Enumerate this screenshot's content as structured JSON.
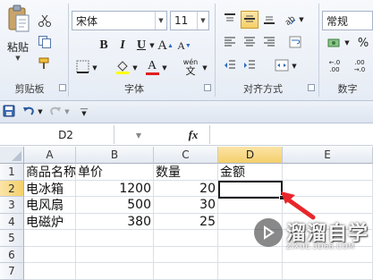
{
  "ribbon": {
    "clipboard": {
      "paste_label": "粘贴",
      "group_label": "剪贴板",
      "cut_icon": "scissors-icon",
      "copy_icon": "copy-icon",
      "format_painter_icon": "format-painter-icon"
    },
    "font": {
      "font_name": "宋体",
      "font_size": "11",
      "bold": "B",
      "italic": "I",
      "underline": "U",
      "grow_font": "A",
      "shrink_font": "A",
      "font_color_glyph": "A",
      "phonetic_label": "wén",
      "group_label": "字体",
      "highlight_color": "#ffff00",
      "font_color": "#e02020"
    },
    "alignment": {
      "group_label": "对齐方式"
    },
    "number": {
      "format_value": "常规",
      "currency_symbol": "$",
      "percent_symbol": "%",
      "comma_symbol": ",",
      "increase_decimal": ".0 .00",
      "decrease_decimal": ".00 .0",
      "group_label": "数字"
    }
  },
  "qat": {
    "save_icon": "save-icon",
    "undo_icon": "undo-icon",
    "redo_icon": "redo-icon"
  },
  "formula_bar": {
    "name_box": "D2",
    "fx": "fx",
    "formula": ""
  },
  "sheet": {
    "columns": [
      "A",
      "B",
      "C",
      "D",
      "E"
    ],
    "selected_column": "D",
    "rows": [
      "1",
      "2",
      "3",
      "4",
      "5",
      "6",
      "7"
    ],
    "selected_row": "2",
    "data": [
      [
        "商品名称",
        "单价",
        "数量",
        "金额",
        ""
      ],
      [
        "电冰箱",
        "1200",
        "20",
        "",
        ""
      ],
      [
        "电风扇",
        "500",
        "30",
        "",
        ""
      ],
      [
        "电磁炉",
        "380",
        "25",
        "",
        ""
      ],
      [
        "",
        "",
        "",
        "",
        ""
      ],
      [
        "",
        "",
        "",
        "",
        ""
      ],
      [
        "",
        "",
        "",
        "",
        ""
      ]
    ],
    "selection_color": "#1e1e1e",
    "arrow_color": "#e8262a"
  },
  "watermark": {
    "text": "溜溜自学",
    "url": "ZIXUE.3D66.COM"
  }
}
